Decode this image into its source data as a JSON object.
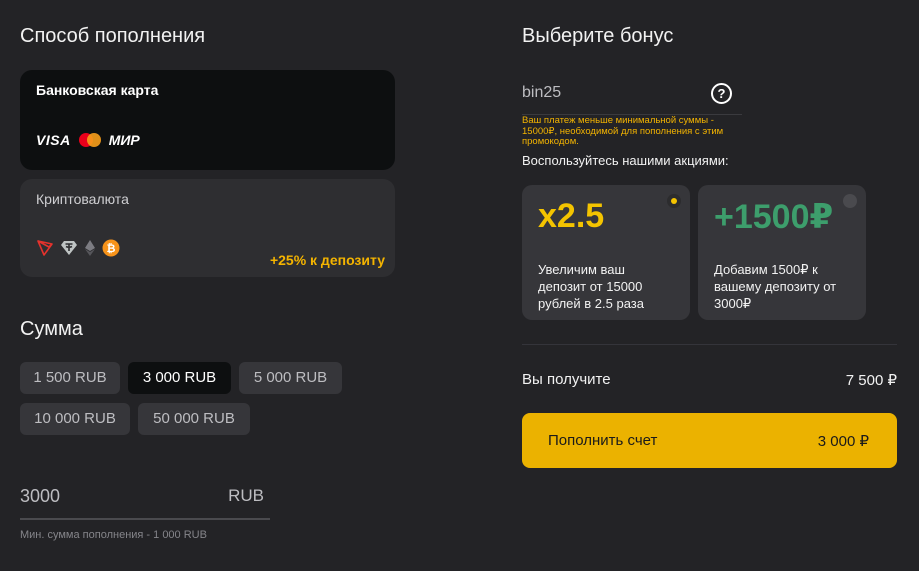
{
  "payment": {
    "title": "Способ пополнения",
    "bank": {
      "label": "Банковская карта",
      "brands": [
        "VISA",
        "mastercard-icon",
        "МИР"
      ]
    },
    "crypto": {
      "label": "Криптовалюта",
      "coins": [
        "tron-icon",
        "tether-icon",
        "ethereum-icon",
        "bitcoin-icon"
      ],
      "promo": "+25% к депозиту"
    }
  },
  "amount": {
    "title": "Сумма",
    "options": [
      "1 500 RUB",
      "3 000 RUB",
      "5 000 RUB",
      "10 000 RUB",
      "50 000 RUB"
    ],
    "selected": "3 000 RUB",
    "value": "3000",
    "currency": "RUB",
    "hint": "Мин. сумма пополнения - 1 000 RUB"
  },
  "bonus": {
    "title": "Выберите бонус",
    "code": "bin25",
    "error": "Ваш платеж меньше минимальной суммы - 15000₽, необходимой для пополнения с этим промокодом.",
    "promos_label": "Воспользуйтесь нашими акциями:",
    "offers": [
      {
        "big": "x2.5",
        "desc": "Увеличим ваш депозит от 15000 рублей в 2.5 раза",
        "color": "#f4c400",
        "selected": true
      },
      {
        "big": "+1500₽",
        "desc": "Добавим 1500₽ к вашему депозиту от 3000₽",
        "color": "#3d9e6c",
        "selected": false
      }
    ]
  },
  "summary": {
    "receive_label": "Вы получите",
    "receive_value": "7 500 ₽"
  },
  "submit": {
    "label": "Пополнить счет",
    "amount": "3 000 ₽",
    "color": "#ebb200"
  }
}
